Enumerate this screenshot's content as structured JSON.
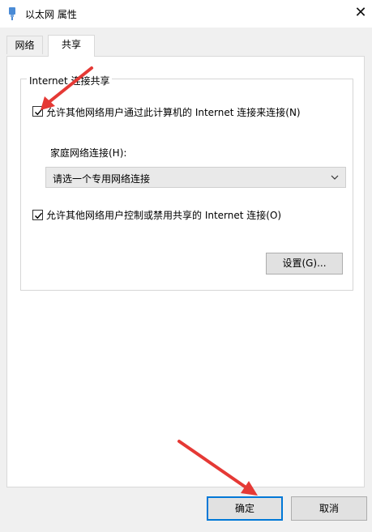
{
  "window": {
    "title": "以太网 属性",
    "close_symbol": "✕"
  },
  "tabs": [
    {
      "label": "网络"
    },
    {
      "label": "共享"
    }
  ],
  "sharing": {
    "group_title": "Internet 连接共享",
    "allow_connect": {
      "label": "允许其他网络用户通过此计算机的 Internet 连接来连接(N)",
      "checked": true
    },
    "home_network": {
      "label": "家庭网络连接(H):",
      "selected": "请选一个专用网络连接"
    },
    "allow_control": {
      "label": "允许其他网络用户控制或禁用共享的 Internet 连接(O)",
      "checked": true
    },
    "settings_button": "设置(G)..."
  },
  "footer": {
    "ok": "确定",
    "cancel": "取消"
  },
  "colors": {
    "annotation_arrow": "#e53935",
    "accent": "#0078d7"
  }
}
